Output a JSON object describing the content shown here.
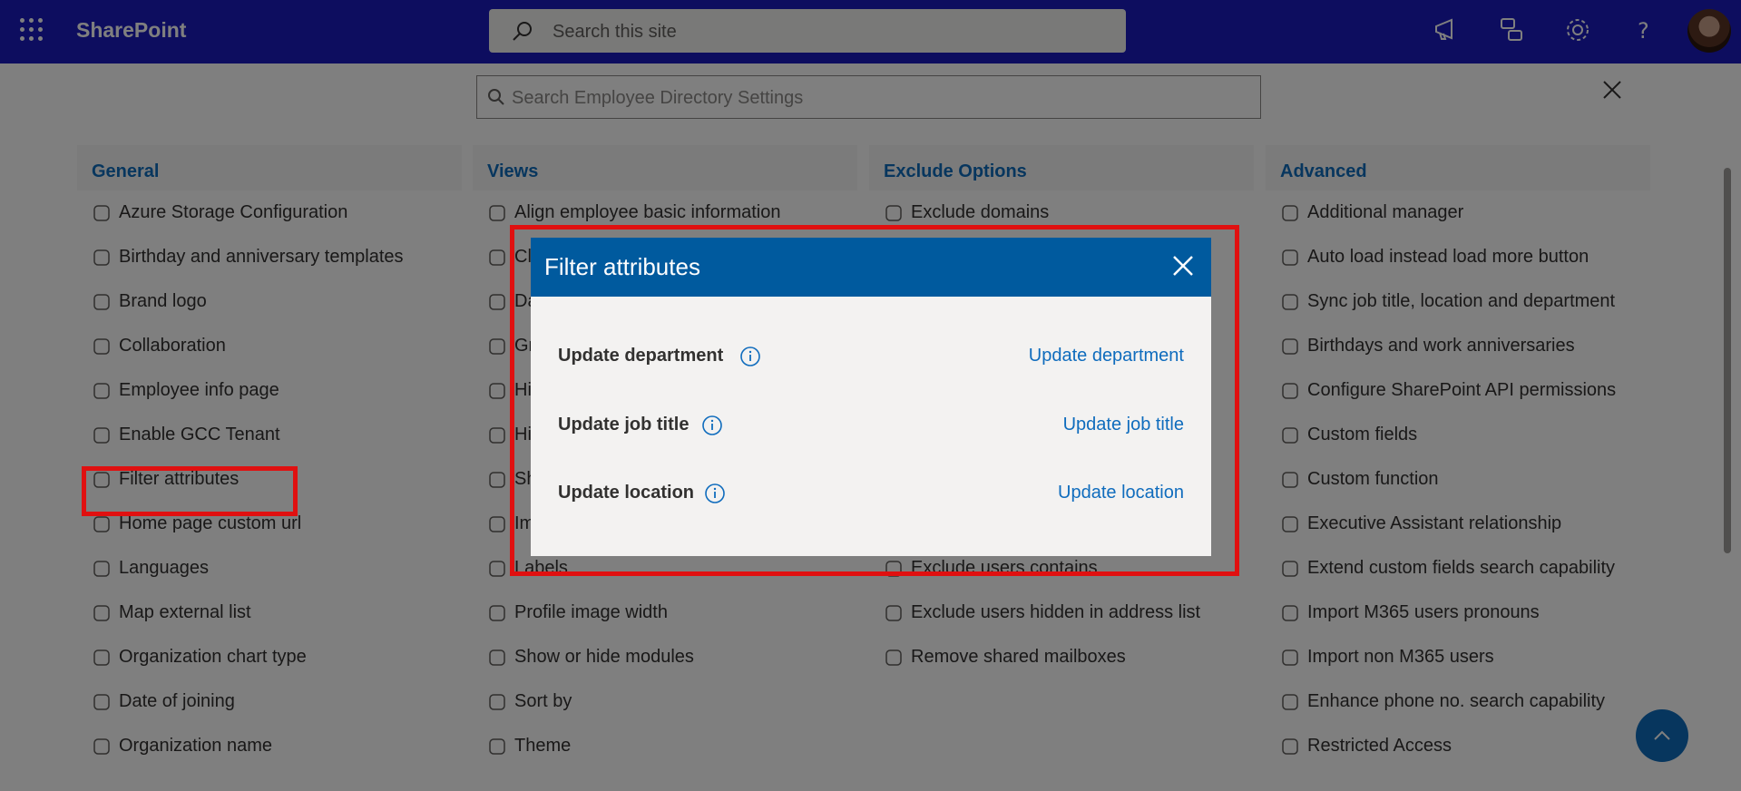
{
  "topbar": {
    "brand": "SharePoint",
    "search_placeholder": "Search this site"
  },
  "panel": {
    "search_placeholder": "Search Employee Directory Settings",
    "columns": [
      {
        "heading": "General",
        "items": [
          {
            "label": "Azure Storage Configuration",
            "icon": "database-icon"
          },
          {
            "label": "Birthday and anniversary templates",
            "icon": "cake-icon"
          },
          {
            "label": "Brand logo",
            "icon": "badge-icon"
          },
          {
            "label": "Collaboration",
            "icon": "handshake-icon"
          },
          {
            "label": "Employee info page",
            "icon": "person-page-icon"
          },
          {
            "label": "Enable GCC Tenant",
            "icon": "globe-icon"
          },
          {
            "label": "Filter attributes",
            "icon": "gear-icon"
          },
          {
            "label": "Home page custom url",
            "icon": "home-icon"
          },
          {
            "label": "Languages",
            "icon": "translate-icon"
          },
          {
            "label": "Map external list",
            "icon": "map-list-icon"
          },
          {
            "label": "Organization chart type",
            "icon": "chart-icon"
          },
          {
            "label": "Date of joining",
            "icon": "calendar-icon"
          },
          {
            "label": "Organization name",
            "icon": "org-chart-icon"
          }
        ]
      },
      {
        "heading": "Views",
        "items": [
          {
            "label": "Align employee basic information",
            "icon": "align-icon"
          },
          {
            "label": "Cl",
            "icon": "filter-icon"
          },
          {
            "label": "Da",
            "icon": "bar-chart-icon"
          },
          {
            "label": "Gr",
            "icon": "grid-icon"
          },
          {
            "label": "Hi",
            "icon": "eye-off-icon"
          },
          {
            "label": "Hi",
            "icon": "eye-off-icon"
          },
          {
            "label": "Sh",
            "icon": "eye-off-icon"
          },
          {
            "label": "Im",
            "icon": "person-icon"
          },
          {
            "label": "Labels",
            "icon": "tag-icon"
          },
          {
            "label": "Profile image width",
            "icon": "layout-icon"
          },
          {
            "label": "Show or hide modules",
            "icon": "eye-icon"
          },
          {
            "label": "Sort by",
            "icon": "sort-icon"
          },
          {
            "label": "Theme",
            "icon": "palette-icon"
          }
        ]
      },
      {
        "heading": "Exclude Options",
        "items": [
          {
            "label": "Exclude domains",
            "icon": "broadcast-icon"
          },
          {
            "label": "",
            "icon": ""
          },
          {
            "label": "",
            "icon": ""
          },
          {
            "label": "",
            "icon": ""
          },
          {
            "label": "",
            "icon": ""
          },
          {
            "label": "",
            "icon": ""
          },
          {
            "label": "",
            "icon": ""
          },
          {
            "label": "",
            "icon": ""
          },
          {
            "label": "Exclude users contains",
            "icon": "people-filter-icon"
          },
          {
            "label": "Exclude users hidden in address list",
            "icon": "list-icon"
          },
          {
            "label": "Remove shared mailboxes",
            "icon": "mailbox-icon"
          }
        ]
      },
      {
        "heading": "Advanced",
        "items": [
          {
            "label": "Additional manager",
            "icon": "people-icon"
          },
          {
            "label": "Auto load instead load more button",
            "icon": "loading-icon"
          },
          {
            "label": "Sync job title, location and department",
            "icon": "sync-icon"
          },
          {
            "label": "Birthdays and work anniversaries",
            "icon": "cake-icon"
          },
          {
            "label": "Configure SharePoint API permissions",
            "icon": "cloud-key-icon"
          },
          {
            "label": "Custom fields",
            "icon": "add-circle-icon"
          },
          {
            "label": "Custom function",
            "icon": "key-icon"
          },
          {
            "label": "Executive Assistant relationship",
            "icon": "people-icon"
          },
          {
            "label": "Extend custom fields search capability",
            "icon": "search-box-icon"
          },
          {
            "label": "Import M365 users pronouns",
            "icon": "id-card-icon"
          },
          {
            "label": "Import non M365 users",
            "icon": "import-icon"
          },
          {
            "label": "Enhance phone no. search capability",
            "icon": "key-icon"
          },
          {
            "label": "Restricted Access",
            "icon": "lock-icon"
          }
        ]
      }
    ]
  },
  "dialog": {
    "title": "Filter attributes",
    "rows": [
      {
        "label": "Update department",
        "action": "Update department"
      },
      {
        "label": "Update job title",
        "action": "Update job title"
      },
      {
        "label": "Update location",
        "action": "Update location"
      }
    ]
  },
  "colors": {
    "topbar": "#1a1abf",
    "accent": "#0f6cbd",
    "dialog_header": "#005a9e",
    "highlight": "#e01010"
  }
}
